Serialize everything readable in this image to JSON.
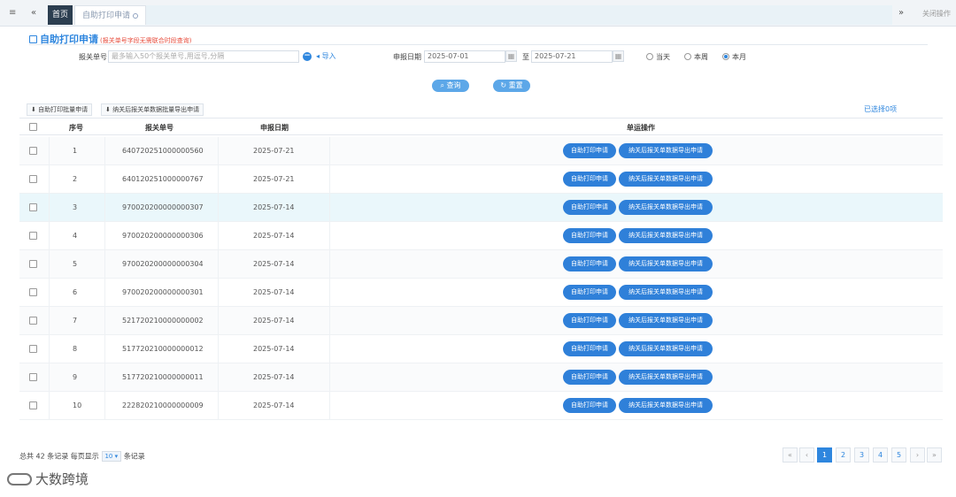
{
  "topbar": {
    "home_tab": "首页",
    "active_tab": "自助打印申请",
    "close_ops": "关闭操作"
  },
  "title": {
    "text": "自助打印申请",
    "note": "(报关单号字段无需联合时段查询)"
  },
  "filters": {
    "declaration_label": "报关单号",
    "declaration_placeholder": "最多输入50个报关单号,用逗号,分隔",
    "import_label": "导入",
    "date_label": "申报日期",
    "date_from": "2025-07-01",
    "date_to_label": "至",
    "date_to": "2025-07-21",
    "ranges": [
      "当天",
      "本周",
      "本月"
    ],
    "selected_range": "本月"
  },
  "actions": {
    "query": "查询",
    "reset": "重置"
  },
  "toolbar": {
    "batch_print": "自助打印批量申请",
    "batch_tax": "纳关后报关单数据批量导出申请",
    "selected_count": "已选择0项"
  },
  "table": {
    "headers": {
      "index": "序号",
      "declaration_no": "报关单号",
      "date": "申报日期",
      "ops": "单运操作"
    },
    "row_btn_print": "自助打印申请",
    "row_btn_export": "纳关后报关单数据导出申请",
    "rows": [
      {
        "index": "1",
        "no": "640720251000000560",
        "date": "2025-07-21"
      },
      {
        "index": "2",
        "no": "640120251000000767",
        "date": "2025-07-21"
      },
      {
        "index": "3",
        "no": "970020200000000307",
        "date": "2025-07-14"
      },
      {
        "index": "4",
        "no": "970020200000000306",
        "date": "2025-07-14"
      },
      {
        "index": "5",
        "no": "970020200000000304",
        "date": "2025-07-14"
      },
      {
        "index": "6",
        "no": "970020200000000301",
        "date": "2025-07-14"
      },
      {
        "index": "7",
        "no": "521720210000000002",
        "date": "2025-07-14"
      },
      {
        "index": "8",
        "no": "517720210000000012",
        "date": "2025-07-14"
      },
      {
        "index": "9",
        "no": "517720210000000011",
        "date": "2025-07-14"
      },
      {
        "index": "10",
        "no": "222820210000000009",
        "date": "2025-07-14"
      }
    ]
  },
  "footer": {
    "total_prefix": "总共 42 条记录 每页显示",
    "page_size": "10",
    "suffix": "条记录",
    "pages": [
      "1",
      "2",
      "3",
      "4",
      "5"
    ],
    "current_page": "1"
  },
  "watermark": {
    "text": "大数跨境"
  }
}
